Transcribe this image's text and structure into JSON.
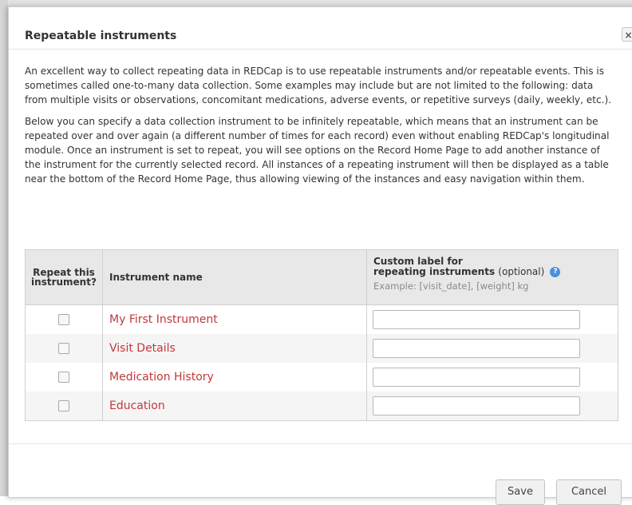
{
  "dialog": {
    "title": "Repeatable instruments",
    "close_glyph": "×",
    "paragraphs": [
      "An excellent way to collect repeating data in REDCap is to use repeatable instruments and/or repeatable events. This is sometimes called one-to-many data collection. Some examples may include but are not limited to the following: data from multiple visits or observations, concomitant medications, adverse events, or repetitive surveys (daily, weekly, etc.).",
      "Below you can specify a data collection instrument to be infinitely repeatable, which means that an instrument can be repeated over and over again (a different number of times for each record) even without enabling REDCap's longitudinal module. Once an instrument is set to repeat, you will see options on the Record Home Page to add another instance of the instrument for the currently selected record. All instances of a repeating instrument will then be displayed as a table near the bottom of the Record Home Page, thus allowing viewing of the instances and easy navigation within them."
    ]
  },
  "table": {
    "header": {
      "repeat_line1": "Repeat this",
      "repeat_line2": "instrument?",
      "instrument_name": "Instrument name",
      "custom_line1": "Custom label for",
      "custom_line2": "repeating instruments",
      "custom_optional": "(optional)",
      "help_glyph": "?",
      "example": "Example: [visit_date], [weight] kg"
    },
    "rows": [
      {
        "name": "My First Instrument",
        "checked": false,
        "label_value": ""
      },
      {
        "name": "Visit Details",
        "checked": false,
        "label_value": ""
      },
      {
        "name": "Medication History",
        "checked": false,
        "label_value": ""
      },
      {
        "name": "Education",
        "checked": false,
        "label_value": ""
      }
    ]
  },
  "footer": {
    "save_label": "Save",
    "cancel_label": "Cancel"
  },
  "colors": {
    "link": "#c0393b",
    "header_bg": "#e8e8e8",
    "help_icon": "#4a8fd9"
  }
}
